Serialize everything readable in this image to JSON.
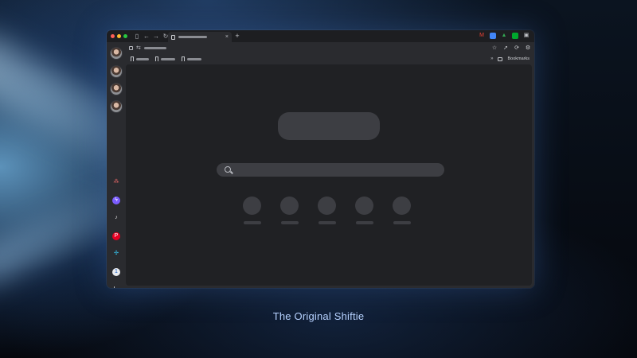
{
  "caption": "The Original Shiftie",
  "bookmarks_bar": {
    "folder_label": "Bookmarks"
  },
  "icons": {
    "window_controls": [
      "close-dot",
      "minimize-dot",
      "maximize-dot"
    ],
    "nav": [
      "sidebar-toggle-icon",
      "back-icon",
      "forward-icon",
      "reload-icon"
    ],
    "tab_close": "×",
    "new_tab": "+",
    "extensions": [
      "gmail-icon",
      "calendar-icon",
      "drive-icon",
      "evernote-icon",
      "extensions-icon"
    ],
    "address_actions": [
      "star-icon",
      "rocket-icon",
      "sync-icon",
      "settings-icon"
    ],
    "sidebar_apps": [
      "asana-icon",
      "messenger-icon",
      "tiktok-icon",
      "pinterest-icon",
      "slack-icon",
      "onepassword-icon",
      "add-app-icon"
    ]
  },
  "colors": {
    "caption": "#b7d2ff",
    "content_bg": "#202124",
    "placeholder": "#3d3e43"
  }
}
